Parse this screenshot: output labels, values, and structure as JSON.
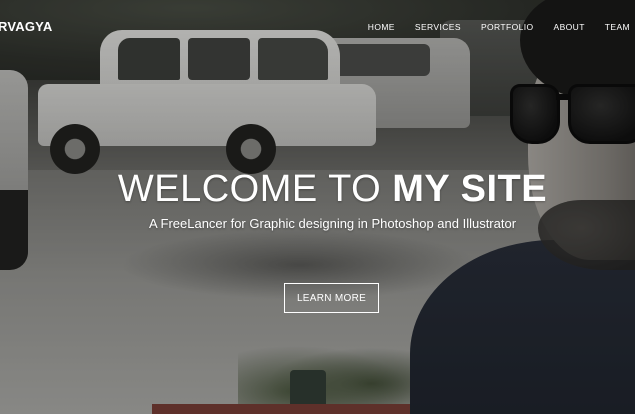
{
  "brand": {
    "name": "RVAGYA"
  },
  "nav": {
    "items": [
      {
        "label": "HOME"
      },
      {
        "label": "SERVICES"
      },
      {
        "label": "PORTFOLIO"
      },
      {
        "label": "ABOUT"
      },
      {
        "label": "TEAM"
      }
    ]
  },
  "hero": {
    "headline_regular": "WELCOME TO",
    "headline_bold": "MY SITE",
    "subheadline": "A FreeLancer for Graphic designing in Photoshop and Illustrator",
    "cta_label": "LEARN MORE"
  },
  "colors": {
    "text": "#ffffff",
    "button_border": "#ffffff"
  }
}
